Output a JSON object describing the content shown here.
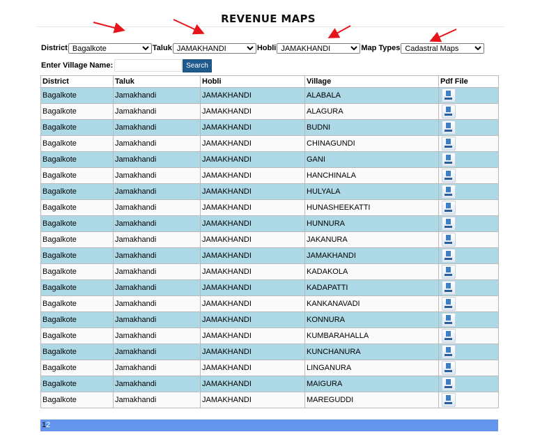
{
  "page": {
    "title": "REVENUE MAPS"
  },
  "filters": {
    "district": {
      "label": "District",
      "value": "Bagalkote"
    },
    "taluk": {
      "label": "Taluk",
      "value": "JAMAKHANDI"
    },
    "hobli": {
      "label": "Hobli",
      "value": "JAMAKHANDI"
    },
    "map_type": {
      "label": "Map Types",
      "value": "Cadastral Maps"
    }
  },
  "search": {
    "label": "Enter Village Name:",
    "value": "",
    "button": "Search"
  },
  "table": {
    "headers": [
      "District",
      "Taluk",
      "Hobli",
      "Village",
      "Pdf File"
    ],
    "rows": [
      [
        "Bagalkote",
        "Jamakhandi",
        "JAMAKHANDI",
        "ALABALA"
      ],
      [
        "Bagalkote",
        "Jamakhandi",
        "JAMAKHANDI",
        "ALAGURA"
      ],
      [
        "Bagalkote",
        "Jamakhandi",
        "JAMAKHANDI",
        "BUDNI"
      ],
      [
        "Bagalkote",
        "Jamakhandi",
        "JAMAKHANDI",
        "CHINAGUNDI"
      ],
      [
        "Bagalkote",
        "Jamakhandi",
        "JAMAKHANDI",
        "GANI"
      ],
      [
        "Bagalkote",
        "Jamakhandi",
        "JAMAKHANDI",
        "HANCHINALA"
      ],
      [
        "Bagalkote",
        "Jamakhandi",
        "JAMAKHANDI",
        "HULYALA"
      ],
      [
        "Bagalkote",
        "Jamakhandi",
        "JAMAKHANDI",
        "HUNASHEEKATTI"
      ],
      [
        "Bagalkote",
        "Jamakhandi",
        "JAMAKHANDI",
        "HUNNURA"
      ],
      [
        "Bagalkote",
        "Jamakhandi",
        "JAMAKHANDI",
        "JAKANURA"
      ],
      [
        "Bagalkote",
        "Jamakhandi",
        "JAMAKHANDI",
        "JAMAKHANDI"
      ],
      [
        "Bagalkote",
        "Jamakhandi",
        "JAMAKHANDI",
        "KADAKOLA"
      ],
      [
        "Bagalkote",
        "Jamakhandi",
        "JAMAKHANDI",
        "KADAPATTI"
      ],
      [
        "Bagalkote",
        "Jamakhandi",
        "JAMAKHANDI",
        "KANKANAVADI"
      ],
      [
        "Bagalkote",
        "Jamakhandi",
        "JAMAKHANDI",
        "KONNURA"
      ],
      [
        "Bagalkote",
        "Jamakhandi",
        "JAMAKHANDI",
        "KUMBARAHALLA"
      ],
      [
        "Bagalkote",
        "Jamakhandi",
        "JAMAKHANDI",
        "KUNCHANURA"
      ],
      [
        "Bagalkote",
        "Jamakhandi",
        "JAMAKHANDI",
        "LINGANURA"
      ],
      [
        "Bagalkote",
        "Jamakhandi",
        "JAMAKHANDI",
        "MAIGURA"
      ],
      [
        "Bagalkote",
        "Jamakhandi",
        "JAMAKHANDI",
        "MAREGUDDI"
      ]
    ],
    "pdf_icon": "pdf-download-icon"
  },
  "pager": {
    "current": "1",
    "pages": [
      "2"
    ]
  },
  "colors": {
    "row_alt": "#add8e6",
    "row_normal": "#fafafa",
    "pager_bg": "#6495ed",
    "search_button": "#1e5b8c",
    "annotation_arrow": "#e8141b"
  }
}
